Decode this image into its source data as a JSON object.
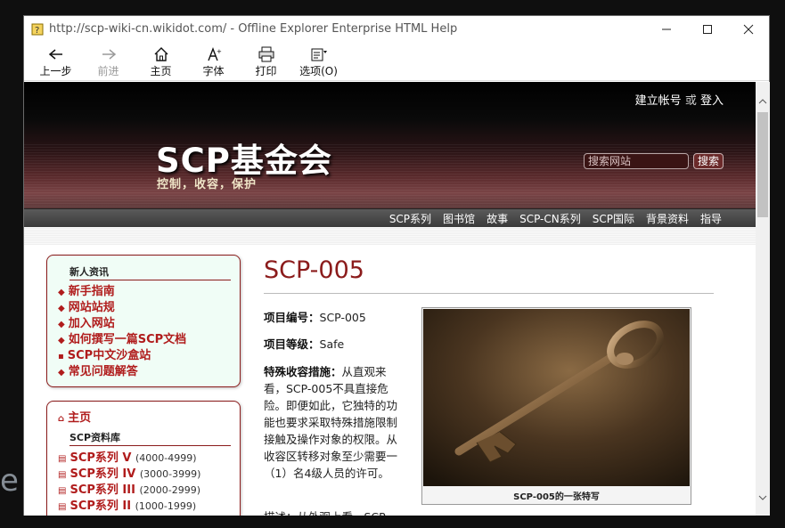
{
  "window": {
    "title": "http://scp-wiki-cn.wikidot.com/ - Offline Explorer Enterprise HTML Help"
  },
  "toolbar": {
    "back": "上一步",
    "forward": "前进",
    "home": "主页",
    "font": "字体",
    "print": "打印",
    "options": "选项(O)"
  },
  "site": {
    "login_create": "建立帐号",
    "login_or": "或",
    "login_signin": "登入",
    "logo": "SCP基金会",
    "slogan": "控制，收容，保护",
    "search_placeholder": "搜索网站",
    "search_button": "搜索",
    "nav": [
      "SCP系列",
      "图书馆",
      "故事",
      "SCP-CN系列",
      "SCP国际",
      "背景资料",
      "指导"
    ]
  },
  "sidebar": {
    "box1_heading": "新人资讯",
    "box1_links": [
      "新手指南",
      "网站站规",
      "加入网站",
      "如何撰写一篇SCP文档",
      "SCP中文沙盒站",
      "常见问题解答"
    ],
    "home": "主页",
    "box2_heading": "SCP资料库",
    "series": [
      {
        "name": "SCP系列 V",
        "range": "(4000-4999)"
      },
      {
        "name": "SCP系列 IV",
        "range": "(3000-3999)"
      },
      {
        "name": "SCP系列 III",
        "range": "(2000-2999)"
      },
      {
        "name": "SCP系列 II",
        "range": "(1000-1999)"
      }
    ]
  },
  "article": {
    "title": "SCP-005",
    "item_label": "项目编号：",
    "item_value": "SCP-005",
    "class_label": "项目等级：",
    "class_value": "Safe",
    "containment_label": "特殊收容措施：",
    "containment_text": "从直观来看，SCP-005不具直接危险。即便如此，它独特的功能也要求采取特殊措施限制接触及操作对象的权限。从收容区转移对象至少需要一（1）名4级人员的许可。",
    "description_partial": "描述：从外观上看，SCP-",
    "figure_caption": "SCP-005的一张特写"
  }
}
